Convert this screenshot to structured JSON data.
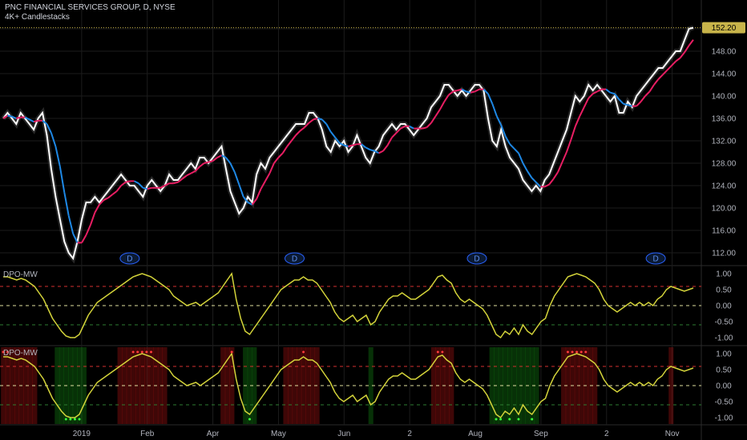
{
  "header": {
    "symbol_line": "PNC FINANCIAL SERVICES GROUP, D, NYSE",
    "indicator_line": "4K+ Candlestacks"
  },
  "price_tag": "152.20",
  "dividend_marker": "D",
  "osc_title": "DPO-MW",
  "colors": {
    "price": "#ffffff",
    "ma_up": "#e91e63",
    "ma_down": "#1e88e5",
    "osc": "#d4d43a",
    "upper_band": "#d32f2f",
    "lower_band": "#2e7d32",
    "mid": "#e0e0a0",
    "grid": "#1c1c1c",
    "price_line": "#c8b44a"
  },
  "chart_data": [
    {
      "type": "line",
      "title": "PNC FINANCIAL SERVICES GROUP, D, NYSE",
      "ylim": [
        110,
        154
      ],
      "y_ticks": [
        "112.00",
        "116.00",
        "120.00",
        "124.00",
        "128.00",
        "132.00",
        "136.00",
        "140.00",
        "144.00",
        "148.00",
        "152.00"
      ],
      "x_ticks": [
        "2019",
        "Feb",
        "Apr",
        "May",
        "Jun",
        "2",
        "Aug",
        "Sep",
        "2",
        "Nov"
      ],
      "last_price": 152.2,
      "series": [
        {
          "values": [
            136,
            137,
            136,
            135,
            137,
            136,
            135,
            134,
            136,
            137,
            133,
            127,
            122,
            118,
            114,
            112,
            111,
            114,
            118,
            121,
            121,
            122,
            121,
            122,
            123,
            124,
            125,
            126,
            125,
            124,
            124,
            123,
            122,
            124,
            125,
            124,
            123,
            124,
            126,
            125,
            125,
            126,
            127,
            128,
            127,
            129,
            129,
            128,
            129,
            130,
            131,
            127,
            123,
            121,
            119,
            120,
            122,
            121,
            126,
            128,
            127,
            129,
            130,
            131,
            132,
            133,
            134,
            135,
            135,
            135,
            137,
            137,
            136,
            134,
            131,
            130,
            132,
            131,
            132,
            130,
            131,
            133,
            131,
            129,
            128,
            130,
            131,
            133,
            134,
            135,
            134,
            135,
            135,
            134,
            133,
            134,
            135,
            136,
            138,
            139,
            140,
            142,
            142,
            141,
            140,
            141,
            140,
            141,
            142,
            142,
            141,
            136,
            132,
            131,
            134,
            131,
            129,
            128,
            127,
            125,
            124,
            123,
            124,
            123,
            125,
            126,
            128,
            130,
            132,
            134,
            137,
            140,
            139,
            140,
            142,
            141,
            142,
            141,
            140,
            139,
            140,
            137,
            137,
            139,
            138,
            140,
            141,
            142,
            143,
            144,
            145,
            145,
            146,
            147,
            148,
            148,
            150,
            152,
            152.2
          ]
        }
      ]
    },
    {
      "type": "line",
      "title": "DPO-MW",
      "ylim": [
        -1.2,
        1.2
      ],
      "y_ticks": [
        "1.00",
        "0.50",
        "0.00",
        "-0.50",
        "-1.00"
      ],
      "bands": {
        "upper": 0.6,
        "mid": 0.0,
        "lower": -0.6
      },
      "series": [
        {
          "values": [
            0.9,
            0.9,
            0.85,
            0.8,
            0.85,
            0.8,
            0.7,
            0.6,
            0.4,
            0.2,
            -0.1,
            -0.4,
            -0.6,
            -0.8,
            -0.95,
            -1.0,
            -1.0,
            -0.9,
            -0.6,
            -0.3,
            -0.1,
            0.1,
            0.2,
            0.3,
            0.4,
            0.5,
            0.6,
            0.7,
            0.8,
            0.9,
            0.95,
            1.0,
            0.95,
            0.9,
            0.8,
            0.7,
            0.6,
            0.5,
            0.3,
            0.2,
            0.1,
            0.0,
            0.05,
            0.1,
            0.0,
            0.1,
            0.2,
            0.3,
            0.4,
            0.6,
            0.8,
            1.0,
            0.2,
            -0.4,
            -0.8,
            -0.9,
            -0.7,
            -0.5,
            -0.3,
            -0.1,
            0.1,
            0.3,
            0.5,
            0.6,
            0.7,
            0.8,
            0.8,
            0.9,
            0.8,
            0.8,
            0.7,
            0.5,
            0.3,
            0.1,
            -0.2,
            -0.4,
            -0.5,
            -0.4,
            -0.3,
            -0.5,
            -0.4,
            -0.3,
            -0.6,
            -0.5,
            -0.2,
            0.0,
            0.2,
            0.3,
            0.3,
            0.4,
            0.3,
            0.2,
            0.2,
            0.3,
            0.4,
            0.5,
            0.7,
            0.9,
            0.95,
            0.8,
            0.7,
            0.4,
            0.2,
            0.1,
            0.2,
            0.1,
            0.0,
            -0.1,
            -0.3,
            -0.6,
            -0.9,
            -1.0,
            -0.8,
            -0.9,
            -0.7,
            -0.9,
            -0.6,
            -0.8,
            -0.9,
            -0.7,
            -0.5,
            -0.4,
            0.0,
            0.3,
            0.5,
            0.7,
            0.9,
            0.95,
            1.0,
            0.95,
            0.9,
            0.8,
            0.7,
            0.5,
            0.2,
            0.0,
            -0.1,
            -0.2,
            -0.1,
            0.0,
            0.1,
            0.0,
            0.1,
            0.0,
            0.1,
            0.0,
            0.2,
            0.3,
            0.5,
            0.6,
            0.55,
            0.5,
            0.45,
            0.5,
            0.55
          ]
        }
      ]
    }
  ]
}
